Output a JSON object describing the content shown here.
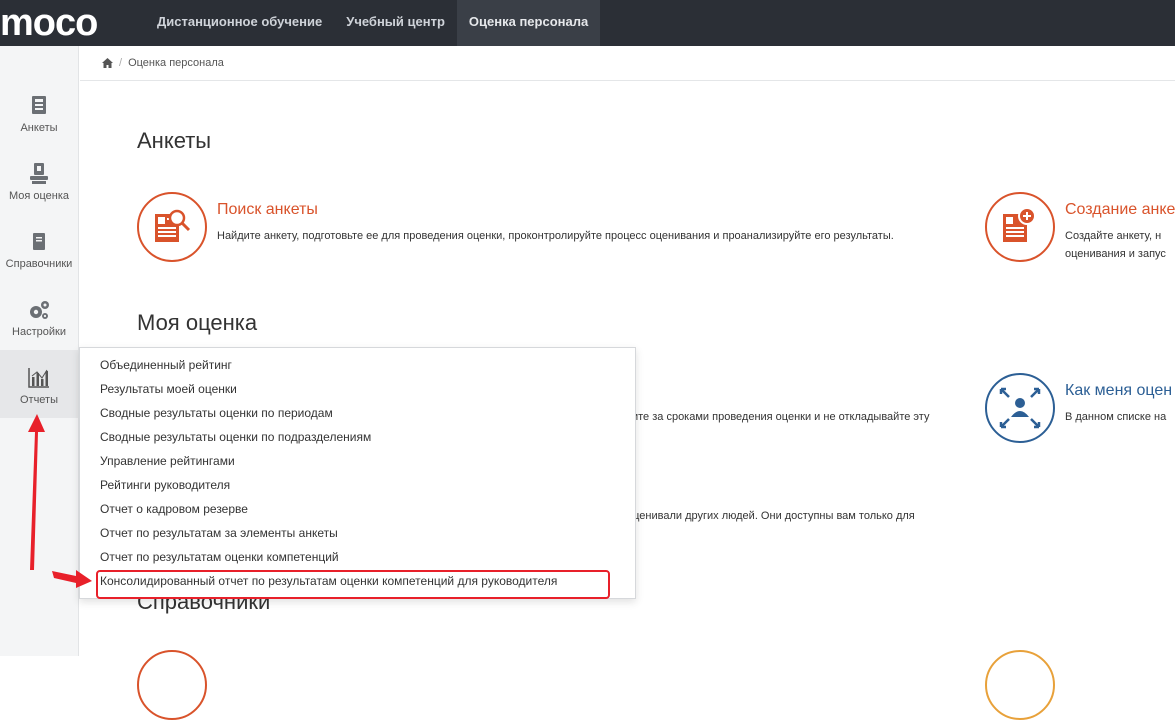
{
  "logo": {
    "text": "MOCO"
  },
  "topnav": {
    "items": [
      {
        "label": "Дистанционное обучение",
        "active": false
      },
      {
        "label": "Учебный центр",
        "active": false
      },
      {
        "label": "Оценка персонала",
        "active": true
      }
    ]
  },
  "sidebar": {
    "items": [
      {
        "label": "Анкеты",
        "icon": "questionnaire-icon"
      },
      {
        "label": "Моя оценка",
        "icon": "my-assessment-icon"
      },
      {
        "label": "Справочники",
        "icon": "reference-book-icon"
      },
      {
        "label": "Настройки",
        "icon": "gears-icon"
      },
      {
        "label": "Отчеты",
        "icon": "bar-chart-icon",
        "active": true
      }
    ]
  },
  "breadcrumb": {
    "home_icon": "home-icon",
    "current": "Оценка персонала"
  },
  "sections": {
    "ankety": {
      "title": "Анкеты",
      "cards": [
        {
          "title": "Поиск анкеты",
          "desc": "Найдите анкету, подготовьте ее для проведения оценки, проконтролируйте процесс оценивания и проанализируйте его результаты."
        },
        {
          "title": "Создание анке",
          "desc_line1": "Создайте анкету, н",
          "desc_line2": "оценивания и запус"
        }
      ]
    },
    "my_assessment": {
      "title": "Моя оценка",
      "partial_text_1": "ите за сроками проведения оценки и не откладывайте эту",
      "partial_text_2": "оценивали других людей. Они доступны вам только для",
      "card_right": {
        "title": "Как меня оцен",
        "desc": "В данном списке на"
      }
    },
    "reference": {
      "title": "Справочники"
    }
  },
  "reports_menu": {
    "items": [
      "Объединенный рейтинг",
      "Результаты моей оценки",
      "Сводные результаты оценки по периодам",
      "Сводные результаты оценки по подразделениям",
      "Управление рейтингами",
      "Рейтинги руководителя",
      "Отчет о кадровом резерве",
      "Отчет по результатам за элементы анкеты",
      "Отчет по результатам оценки компетенций",
      "Консолидированный отчет по результатам оценки компетенций для руководителя"
    ],
    "highlighted_index": 9
  },
  "colors": {
    "accent_orange": "#d9532b",
    "accent_blue": "#2c5f95",
    "annotation_red": "#e8202a",
    "topbar": "#2b2f36"
  }
}
